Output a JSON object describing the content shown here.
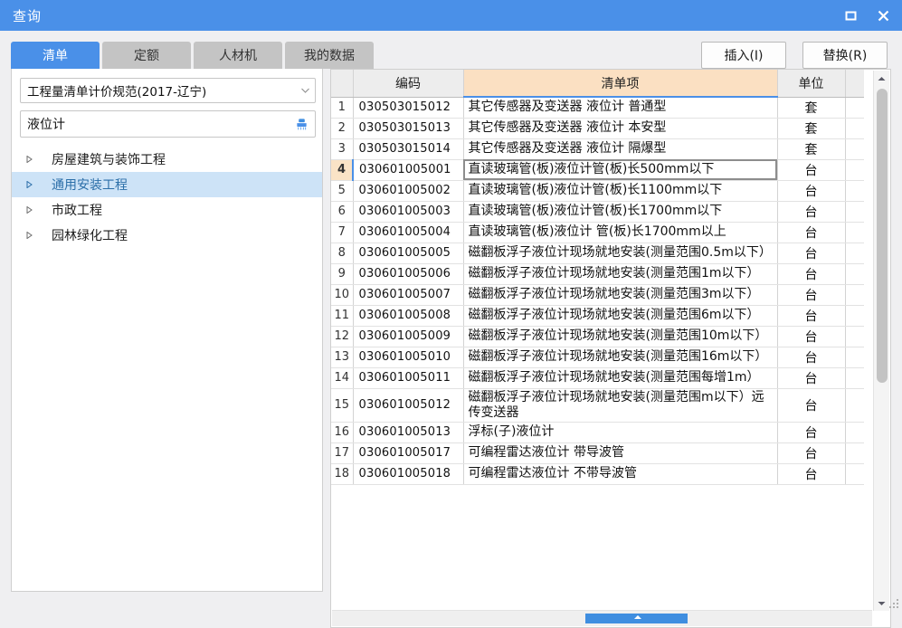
{
  "window": {
    "title": "查询",
    "controls": [
      {
        "name": "maximize-button",
        "icon": "maximize-icon"
      },
      {
        "name": "close-button",
        "icon": "close-icon"
      }
    ],
    "accent_color": "#4a90e8"
  },
  "tabs": [
    {
      "label": "清单",
      "active": true
    },
    {
      "label": "定额",
      "active": false
    },
    {
      "label": "人材机",
      "active": false
    },
    {
      "label": "我的数据",
      "active": false
    }
  ],
  "toolbar": {
    "insert_label": "插入(I)",
    "replace_label": "替换(R)"
  },
  "left_panel": {
    "standard_select": {
      "value": "工程量清单计价规范(2017-辽宁)",
      "arrow_icon": "chevron-down-icon"
    },
    "search": {
      "value": "液位计",
      "placeholder": "",
      "clear_icon": "broom-clear-icon"
    },
    "tree": [
      {
        "label": "房屋建筑与装饰工程",
        "selected": false,
        "arrow_icon": "triangle-right-icon"
      },
      {
        "label": "通用安装工程",
        "selected": true,
        "arrow_icon": "triangle-right-icon"
      },
      {
        "label": "市政工程",
        "selected": false,
        "arrow_icon": "triangle-right-icon"
      },
      {
        "label": "园林绿化工程",
        "selected": false,
        "arrow_icon": "triangle-right-icon"
      }
    ]
  },
  "grid": {
    "headers": {
      "num": "",
      "code": "编码",
      "item": "清单项",
      "unit": "单位"
    },
    "header_highlight_color": "#fbe0c2",
    "selected_row_index": 4,
    "rows": [
      {
        "num": "1",
        "code": "030503015012",
        "item": "其它传感器及变送器 液位计 普通型",
        "unit": "套",
        "selected": false
      },
      {
        "num": "2",
        "code": "030503015013",
        "item": "其它传感器及变送器 液位计 本安型",
        "unit": "套",
        "selected": false
      },
      {
        "num": "3",
        "code": "030503015014",
        "item": "其它传感器及变送器 液位计 隔爆型",
        "unit": "套",
        "selected": false
      },
      {
        "num": "4",
        "code": "030601005001",
        "item": "直读玻璃管(板)液位计管(板)长500mm以下",
        "unit": "台",
        "selected": true
      },
      {
        "num": "5",
        "code": "030601005002",
        "item": "直读玻璃管(板)液位计管(板)长1100mm以下",
        "unit": "台",
        "selected": false
      },
      {
        "num": "6",
        "code": "030601005003",
        "item": "直读玻璃管(板)液位计管(板)长1700mm以下",
        "unit": "台",
        "selected": false
      },
      {
        "num": "7",
        "code": "030601005004",
        "item": "直读玻璃管(板)液位计 管(板)长1700mm以上",
        "unit": "台",
        "selected": false
      },
      {
        "num": "8",
        "code": "030601005005",
        "item": "磁翻板浮子液位计现场就地安装(测量范围0.5m以下）",
        "unit": "台",
        "selected": false
      },
      {
        "num": "9",
        "code": "030601005006",
        "item": "磁翻板浮子液位计现场就地安装(测量范围1m以下）",
        "unit": "台",
        "selected": false
      },
      {
        "num": "10",
        "code": "030601005007",
        "item": "磁翻板浮子液位计现场就地安装(测量范围3m以下）",
        "unit": "台",
        "selected": false
      },
      {
        "num": "11",
        "code": "030601005008",
        "item": "磁翻板浮子液位计现场就地安装(测量范围6m以下）",
        "unit": "台",
        "selected": false
      },
      {
        "num": "12",
        "code": "030601005009",
        "item": "磁翻板浮子液位计现场就地安装(测量范围10m以下）",
        "unit": "台",
        "selected": false
      },
      {
        "num": "13",
        "code": "030601005010",
        "item": "磁翻板浮子液位计现场就地安装(测量范围16m以下）",
        "unit": "台",
        "selected": false
      },
      {
        "num": "14",
        "code": "030601005011",
        "item": "磁翻板浮子液位计现场就地安装(测量范围每增1m）",
        "unit": "台",
        "selected": false
      },
      {
        "num": "15",
        "code": "030601005012",
        "item": "磁翻板浮子液位计现场就地安装(测量范围m以下）远传变送器",
        "unit": "台",
        "selected": false
      },
      {
        "num": "16",
        "code": "030601005013",
        "item": "浮标(子)液位计",
        "unit": "台",
        "selected": false
      },
      {
        "num": "17",
        "code": "030601005017",
        "item": "可编程雷达液位计 带导波管",
        "unit": "台",
        "selected": false
      },
      {
        "num": "18",
        "code": "030601005018",
        "item": "可编程雷达液位计 不带导波管",
        "unit": "台",
        "selected": false
      }
    ]
  },
  "scrollbars": {
    "vertical": {
      "up_icon": "triangle-up-icon",
      "down_icon": "triangle-down-icon"
    },
    "horizontal": {
      "marker_icon": "triangle-up-icon"
    }
  }
}
